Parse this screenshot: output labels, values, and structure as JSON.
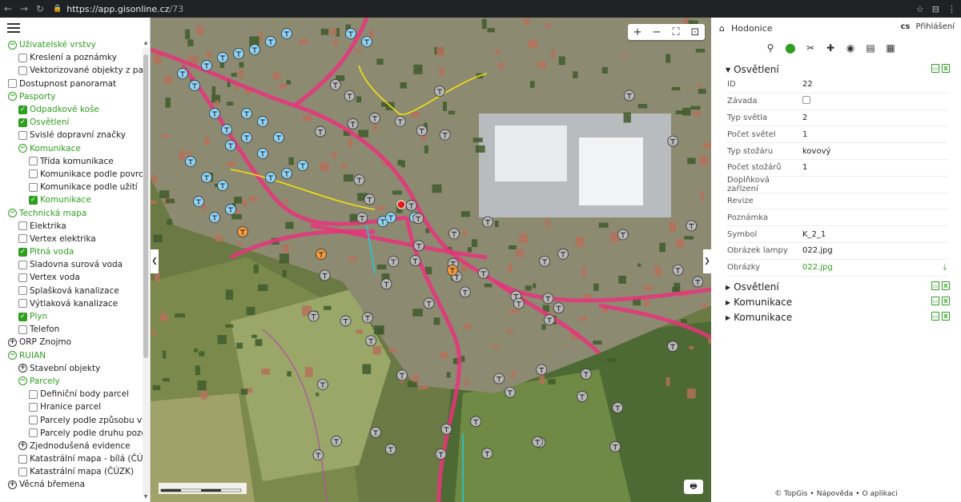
{
  "browser": {
    "url_host": "https://app.gisonline.cz",
    "url_path": "/73"
  },
  "left_panel": {
    "layers": [
      {
        "label": "Uživatelské vrstvy",
        "level": 0,
        "control": "expander",
        "state": "expanded",
        "green": true
      },
      {
        "label": "Kreslení a poznámky",
        "level": 1,
        "control": "checkbox",
        "checked": false
      },
      {
        "label": "Vektorizované objekty z panoram",
        "level": 1,
        "control": "checkbox",
        "checked": false
      },
      {
        "label": "Dostupnost panoramat",
        "level": 0,
        "control": "checkbox",
        "checked": false
      },
      {
        "label": "Pasporty",
        "level": 0,
        "control": "expander",
        "state": "expanded",
        "green": true
      },
      {
        "label": "Odpadkové koše",
        "level": 1,
        "control": "checkbox",
        "checked": true,
        "green": true
      },
      {
        "label": "Osvětlení",
        "level": 1,
        "control": "checkbox",
        "checked": true,
        "green": true
      },
      {
        "label": "Svislé dopravní značky",
        "level": 1,
        "control": "checkbox",
        "checked": false
      },
      {
        "label": "Komunikace",
        "level": 1,
        "control": "expander",
        "state": "expanded",
        "green": true
      },
      {
        "label": "Třída komunikace",
        "level": 2,
        "control": "checkbox",
        "checked": false
      },
      {
        "label": "Komunikace podle povrchu",
        "level": 2,
        "control": "checkbox",
        "checked": false
      },
      {
        "label": "Komunikace podle užití",
        "level": 2,
        "control": "checkbox",
        "checked": false
      },
      {
        "label": "Komunikace",
        "level": 2,
        "control": "checkbox",
        "checked": true,
        "green": true
      },
      {
        "label": "Technická mapa",
        "level": 0,
        "control": "expander",
        "state": "expanded",
        "green": true
      },
      {
        "label": "Elektrika",
        "level": 1,
        "control": "checkbox",
        "checked": false
      },
      {
        "label": "Vertex elektrika",
        "level": 1,
        "control": "checkbox",
        "checked": false
      },
      {
        "label": "Pitná voda",
        "level": 1,
        "control": "checkbox",
        "checked": true,
        "green": true
      },
      {
        "label": "Sladovna surová voda",
        "level": 1,
        "control": "checkbox",
        "checked": false
      },
      {
        "label": "Vertex voda",
        "level": 1,
        "control": "checkbox",
        "checked": false
      },
      {
        "label": "Splašková kanalizace",
        "level": 1,
        "control": "checkbox",
        "checked": false
      },
      {
        "label": "Výtlaková kanalizace",
        "level": 1,
        "control": "checkbox",
        "checked": false
      },
      {
        "label": "Plyn",
        "level": 1,
        "control": "checkbox",
        "checked": true,
        "green": true
      },
      {
        "label": "Telefon",
        "level": 1,
        "control": "checkbox",
        "checked": false
      },
      {
        "label": "ORP Znojmo",
        "level": 0,
        "control": "expander",
        "state": "collapsed"
      },
      {
        "label": "RUIAN",
        "level": 0,
        "control": "expander",
        "state": "expanded",
        "green": true
      },
      {
        "label": "Stavební objekty",
        "level": 1,
        "control": "expander",
        "state": "collapsed"
      },
      {
        "label": "Parcely",
        "level": 1,
        "control": "expander",
        "state": "expanded",
        "green": true
      },
      {
        "label": "Definiční body parcel",
        "level": 2,
        "control": "checkbox",
        "checked": false
      },
      {
        "label": "Hranice parcel",
        "level": 2,
        "control": "checkbox",
        "checked": false
      },
      {
        "label": "Parcely podle způsobu využití",
        "level": 2,
        "control": "checkbox",
        "checked": false
      },
      {
        "label": "Parcely podle druhu pozemku",
        "level": 2,
        "control": "checkbox",
        "checked": false
      },
      {
        "label": "Zjednodušená evidence",
        "level": 1,
        "control": "expander",
        "state": "collapsed"
      },
      {
        "label": "Katastrální mapa - bílá (ČÚZK)",
        "level": 1,
        "control": "checkbox",
        "checked": false
      },
      {
        "label": "Katastrální mapa (ČÚZK)",
        "level": 1,
        "control": "checkbox",
        "checked": false
      },
      {
        "label": "Věcná břemena",
        "level": 0,
        "control": "expander",
        "state": "collapsed"
      }
    ]
  },
  "map": {
    "tools": [
      {
        "name": "zoom-in-button",
        "glyph": "+"
      },
      {
        "name": "zoom-out-button",
        "glyph": "−"
      },
      {
        "name": "fullscreen-button",
        "glyph": "⛶"
      },
      {
        "name": "extent-button",
        "glyph": "⊡"
      }
    ]
  },
  "right_panel": {
    "header": {
      "title": "Hodonice",
      "lang": "cs",
      "login": "Přihlášení"
    },
    "toolbar": [
      {
        "name": "search-icon",
        "glyph": "⚲"
      },
      {
        "name": "identify-marker-icon",
        "glyph": "⬤",
        "active": true
      },
      {
        "name": "measure-icon",
        "glyph": "✂"
      },
      {
        "name": "place-marker-icon",
        "glyph": "✚"
      },
      {
        "name": "eye-icon",
        "glyph": "◉"
      },
      {
        "name": "map-book-icon",
        "glyph": "▤"
      },
      {
        "name": "table-icon",
        "glyph": "▦"
      }
    ],
    "sections": [
      {
        "title": "Osvětlení",
        "expanded": true
      },
      {
        "title": "Osvětlení",
        "expanded": false
      },
      {
        "title": "Komunikace",
        "expanded": false
      },
      {
        "title": "Komunikace",
        "expanded": false
      }
    ],
    "properties": [
      {
        "key": "ID",
        "value": "22"
      },
      {
        "key": "Závada",
        "value": "",
        "checkbox": true
      },
      {
        "key": "Typ světla",
        "value": "2"
      },
      {
        "key": "Počet světel",
        "value": "1"
      },
      {
        "key": "Typ stožáru",
        "value": "kovový"
      },
      {
        "key": "Počet stožárů",
        "value": "1"
      },
      {
        "key": "Doplňková zařízení",
        "value": ""
      },
      {
        "key": "Revize",
        "value": ""
      },
      {
        "key": "Poznámka",
        "value": ""
      },
      {
        "key": "Symbol",
        "value": "K_2_1"
      },
      {
        "key": "Obrázek lampy",
        "value": "022.jpg"
      },
      {
        "key": "Obrázky",
        "value": "022.jpg",
        "link": true
      }
    ],
    "footer": {
      "brand": "© TopGis",
      "help": "Nápověda",
      "about": "O aplikaci"
    }
  },
  "colors": {
    "accent_green": "#2e9e1f",
    "road_pink": "#e8327a",
    "gas_yellow": "#f2e20c",
    "water_cyan": "#22c9d9",
    "marker_blue": "#8fd3f4",
    "marker_gray": "#b8b8b8",
    "marker_orange": "#f39a3c"
  }
}
